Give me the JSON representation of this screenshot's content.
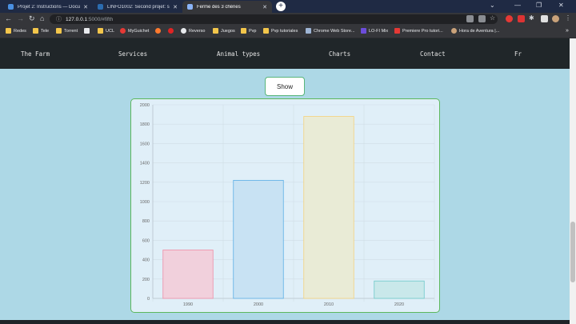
{
  "browser": {
    "tabs": [
      {
        "title": "Projet 2: Instructions — Docume",
        "color": "#4a90e2",
        "active": false
      },
      {
        "title": "LINFO1002: Second projet: sour",
        "color": "#2b6cb0",
        "active": false
      },
      {
        "title": "Ferme des 3 chênes",
        "color": "#8ab4f8",
        "active": true
      }
    ],
    "close_glyph": "✕",
    "new_tab_glyph": "+",
    "url_host": "127.0.0.1",
    "url_rest": ":5000/#fifth",
    "bookmarks": [
      {
        "label": "Redes",
        "icon": "folder"
      },
      {
        "label": "Tele",
        "icon": "folder"
      },
      {
        "label": "Torrent",
        "icon": "folder"
      },
      {
        "label": "",
        "icon": "ghost"
      },
      {
        "label": "UCL",
        "icon": "folder"
      },
      {
        "label": "MyGuichet",
        "icon": "red"
      },
      {
        "label": "",
        "icon": "orange"
      },
      {
        "label": "",
        "icon": "red2"
      },
      {
        "label": "Reverso",
        "icon": "reverso"
      },
      {
        "label": "Juegos",
        "icon": "folder"
      },
      {
        "label": "Pvp",
        "icon": "folder"
      },
      {
        "label": "Pvp tutoriales",
        "icon": "folder"
      },
      {
        "label": "Chrome Web Store...",
        "icon": "store"
      },
      {
        "label": "LO-FI Mix",
        "icon": "lofi"
      },
      {
        "label": "Premiere Pro tutori...",
        "icon": "adobe"
      },
      {
        "label": "Hora de Aventura |...",
        "icon": "hora"
      }
    ]
  },
  "site_nav": {
    "items": [
      "The Farm",
      "Services",
      "Animal types",
      "Charts",
      "Contact",
      "Fr"
    ]
  },
  "show_button": "Show",
  "chart_data": {
    "type": "bar",
    "categories": [
      "1990",
      "2000",
      "2010",
      "2020"
    ],
    "values": [
      500,
      1220,
      1880,
      180
    ],
    "ylim": [
      0,
      2000
    ],
    "yticks": [
      0,
      200,
      400,
      600,
      800,
      1000,
      1200,
      1400,
      1600,
      1800,
      2000
    ],
    "colors": [
      {
        "fill": "#f1d0dc",
        "stroke": "#f08ca5"
      },
      {
        "fill": "#c8e2f3",
        "stroke": "#5aaee6"
      },
      {
        "fill": "#e9ebd6",
        "stroke": "#f5d27a"
      },
      {
        "fill": "#c9e8ea",
        "stroke": "#6cc9c9"
      }
    ],
    "grid": true,
    "legend": "none",
    "title": "",
    "xlabel": "",
    "ylabel": ""
  }
}
